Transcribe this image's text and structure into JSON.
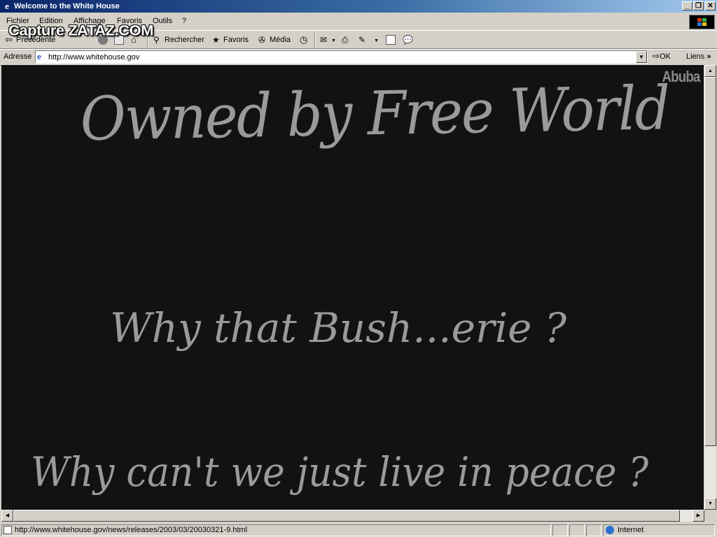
{
  "window": {
    "title": "Welcome to the White House",
    "minimize_glyph": "_",
    "maximize_glyph": "❐",
    "close_glyph": "✕"
  },
  "menu": {
    "items": [
      "Fichier",
      "Edition",
      "Affichage",
      "Favoris",
      "Outils",
      "?"
    ]
  },
  "watermark": "Capture ZATAZ.COM",
  "toolbar": {
    "back_label": "Précédente",
    "search_label": "Rechercher",
    "favorites_label": "Favoris",
    "media_label": "Média"
  },
  "address": {
    "label": "Adresse",
    "url": "http://www.whitehouse.gov",
    "go_label": "OK",
    "links_label": "Liens",
    "links_chevron": "»"
  },
  "page": {
    "signature": "Abuba",
    "headline": "Owned by Free World",
    "line2": "Why that Bush...erie ?",
    "line3": "Why can't we just live in peace ?",
    "background_color": "#121212",
    "text_color": "#9a9a9a"
  },
  "statusbar": {
    "url": "http://www.whitehouse.gov/news/releases/2003/03/20030321-9.html",
    "zone": "Internet"
  },
  "icons": {
    "ie": "ie-page-icon",
    "back": "back-arrow-icon",
    "stop": "stop-icon",
    "refresh": "refresh-icon",
    "home": "home-icon",
    "search": "search-icon",
    "favorites": "favorites-icon",
    "media": "media-icon",
    "history": "history-icon",
    "mail": "mail-icon",
    "print": "print-icon",
    "edit": "edit-icon",
    "discuss": "discuss-icon",
    "go": "go-arrow-icon",
    "globe": "internet-globe-icon"
  }
}
